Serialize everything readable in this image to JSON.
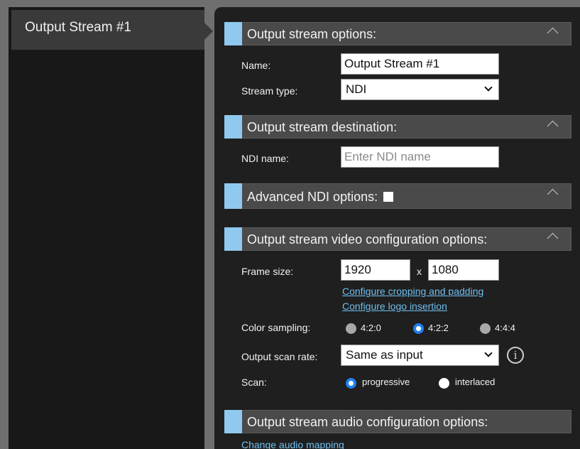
{
  "stream_tab": {
    "label": "Output Stream #1"
  },
  "sections": {
    "options": {
      "title": "Output stream options:"
    },
    "destination": {
      "title": "Output stream destination:"
    },
    "advanced": {
      "title": "Advanced NDI options:",
      "checked": false
    },
    "video": {
      "title": "Output stream video configuration options:"
    },
    "audio": {
      "title": "Output stream audio configuration options:"
    }
  },
  "fields": {
    "name": {
      "label": "Name:",
      "value": "Output Stream #1"
    },
    "stream_type": {
      "label": "Stream type:",
      "value": "NDI"
    },
    "ndi_name": {
      "label": "NDI name:",
      "value": "",
      "placeholder": "Enter NDI name"
    },
    "frame_size": {
      "label": "Frame size:",
      "width": "1920",
      "separator": "x",
      "height": "1080"
    },
    "color_sampling": {
      "label": "Color sampling:",
      "options": [
        "4:2:0",
        "4:2:2",
        "4:4:4"
      ],
      "selected": "4:2:2"
    },
    "scan_rate": {
      "label": "Output scan rate:",
      "value": "Same as input"
    },
    "scan": {
      "label": "Scan:",
      "options": [
        "progressive",
        "interlaced"
      ],
      "selected": "progressive"
    }
  },
  "links": {
    "cropping": "Configure cropping and padding",
    "logo": "Configure logo insertion",
    "audio_mapping": "Change audio mapping"
  },
  "colors": {
    "accent": "#8fc9f0",
    "link": "#6fbfef",
    "radio_selected": "#1f7ff0"
  }
}
